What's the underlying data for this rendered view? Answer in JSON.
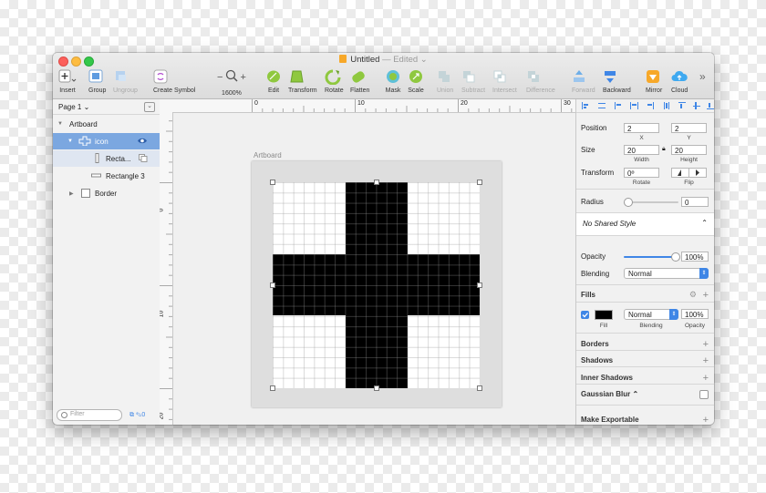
{
  "window": {
    "title": "Untitled",
    "title_status": "— Edited ⌄"
  },
  "toolbar": {
    "insert": "Insert",
    "group": "Group",
    "ungroup": "Ungroup",
    "create_symbol": "Create Symbol",
    "zoom": "1600%",
    "zoom_minus": "−",
    "zoom_plus": "+",
    "edit": "Edit",
    "transform": "Transform",
    "rotate": "Rotate",
    "flatten": "Flatten",
    "mask": "Mask",
    "scale": "Scale",
    "union": "Union",
    "subtract": "Subtract",
    "intersect": "Intersect",
    "difference": "Difference",
    "forward": "Forward",
    "backward": "Backward",
    "mirror": "Mirror",
    "cloud": "Cloud",
    "more": "»"
  },
  "layers": {
    "page": "Page 1 ⌄",
    "items": [
      {
        "label": "Artboard",
        "arrow": "▼"
      },
      {
        "label": "icon",
        "arrow": "▼"
      },
      {
        "label": "Recta..."
      },
      {
        "label": "Rectangle 3"
      },
      {
        "label": "Border",
        "arrow": "▶"
      }
    ],
    "filter_placeholder": "Filter",
    "filter_count": "0"
  },
  "rulers": {
    "h_ticks": [
      "0",
      "10",
      "20",
      "30"
    ],
    "v_ticks": [
      "0",
      "10",
      "20"
    ]
  },
  "canvas": {
    "artboard_label": "Artboard"
  },
  "inspector": {
    "position_label": "Position",
    "x": "2",
    "y": "2",
    "x_label": "X",
    "y_label": "Y",
    "size_label": "Size",
    "width": "20",
    "height": "20",
    "width_label": "Width",
    "height_label": "Height",
    "transform_label": "Transform",
    "rotate": "0º",
    "rotate_label": "Rotate",
    "flip_label": "Flip",
    "radius_label": "Radius",
    "radius": "0",
    "shared_style": "No Shared Style",
    "opacity_label": "Opacity",
    "opacity": "100%",
    "opacity_value": 1.0,
    "blending_label": "Blending",
    "blending": "Normal",
    "fills_label": "Fills",
    "fill_blending": "Normal",
    "fill_opacity": "100%",
    "fill_label": "Fill",
    "fill_blending_label": "Blending",
    "fill_opacity_label": "Opacity",
    "fill_color": "#000000",
    "borders": "Borders",
    "shadows": "Shadows",
    "inner_shadows": "Inner Shadows",
    "gaussian_blur": "Gaussian Blur ⌃",
    "make_exportable": "Make Exportable"
  },
  "colors": {
    "accent": "#3f86e6",
    "selection": "#7ba7e0"
  }
}
